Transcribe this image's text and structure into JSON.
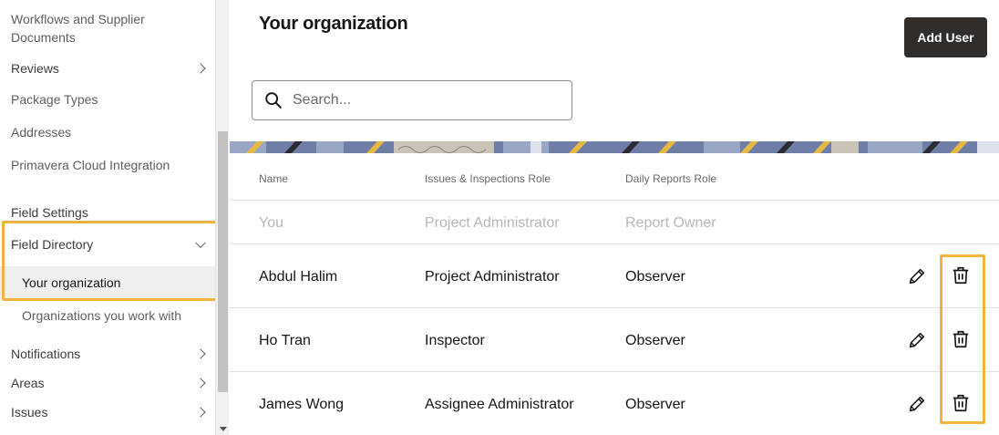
{
  "sidebar": {
    "items": [
      {
        "label": "Workflows and Supplier"
      },
      {
        "label": "Documents"
      },
      {
        "label": "Reviews"
      },
      {
        "label": "Package Types"
      },
      {
        "label": "Addresses"
      },
      {
        "label": "Primavera Cloud Integration"
      },
      {
        "label": "Field Settings"
      },
      {
        "label": "Field Directory"
      },
      {
        "label": "Your organization"
      },
      {
        "label": "Organizations you work with"
      },
      {
        "label": "Notifications"
      },
      {
        "label": "Areas"
      },
      {
        "label": "Issues"
      }
    ]
  },
  "header": {
    "title": "Your organization",
    "add_user_label": "Add User"
  },
  "search": {
    "placeholder": "Search..."
  },
  "table": {
    "columns": [
      "Name",
      "Issues & Inspections Role",
      "Daily Reports Role"
    ],
    "rows": [
      {
        "name": "You",
        "issues_role": "Project Administrator",
        "reports_role": "Report Owner"
      },
      {
        "name": "Abdul Halim",
        "issues_role": "Project Administrator",
        "reports_role": "Observer"
      },
      {
        "name": "Ho Tran",
        "issues_role": "Inspector",
        "reports_role": "Observer"
      },
      {
        "name": "James Wong",
        "issues_role": "Assignee Administrator",
        "reports_role": "Observer"
      }
    ]
  },
  "colors": {
    "highlight": "#f0b43c",
    "button_bg": "#312d2a",
    "active_bg": "#f0efed"
  },
  "icons": {
    "search": "search-icon",
    "edit": "pencil-icon",
    "delete": "trash-icon",
    "expand": "chevron-right-icon",
    "collapse": "chevron-down-icon"
  }
}
